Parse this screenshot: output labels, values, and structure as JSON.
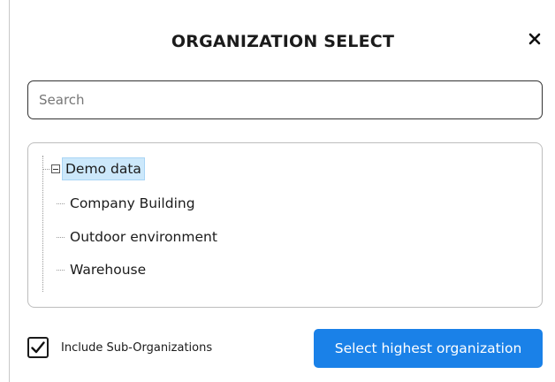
{
  "dialog": {
    "title": "ORGANIZATION SELECT",
    "close_icon": "close-icon"
  },
  "search": {
    "placeholder": "Search",
    "value": ""
  },
  "tree": {
    "root": {
      "label": "Demo data",
      "expanded": true,
      "selected": true
    },
    "children": [
      {
        "label": "Company Building"
      },
      {
        "label": "Outdoor environment"
      },
      {
        "label": "Warehouse"
      }
    ]
  },
  "options": {
    "include_sub_label": "Include Sub-Organizations",
    "include_sub_checked": true
  },
  "actions": {
    "select_highest_label": "Select highest organization"
  },
  "colors": {
    "accent": "#1a81e8",
    "selected_bg": "#cce8fb"
  }
}
